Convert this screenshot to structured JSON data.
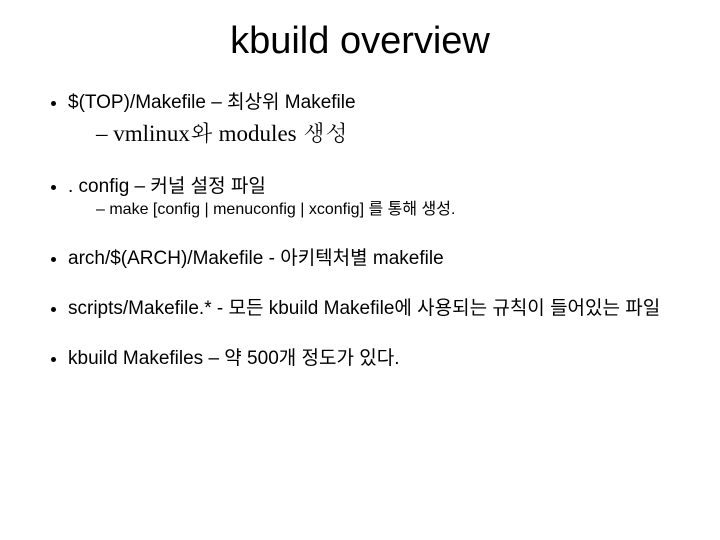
{
  "title": "kbuild overview",
  "items": [
    {
      "text": "$(TOP)/Makefile – 최상위 Makefile",
      "sub_serif": "vmlinux와 modules 생성"
    },
    {
      "text": ". config – 커널 설정 파일",
      "sub_small": "make [config | menuconfig | xconfig] 를 통해 생성."
    },
    {
      "text": "arch/$(ARCH)/Makefile - 아키텍처별 makefile"
    },
    {
      "text": "scripts/Makefile.* - 모든 kbuild Makefile에 사용되는 규칙이 들어있는 파일"
    },
    {
      "text": "kbuild Makefiles – 약 500개 정도가 있다."
    }
  ]
}
